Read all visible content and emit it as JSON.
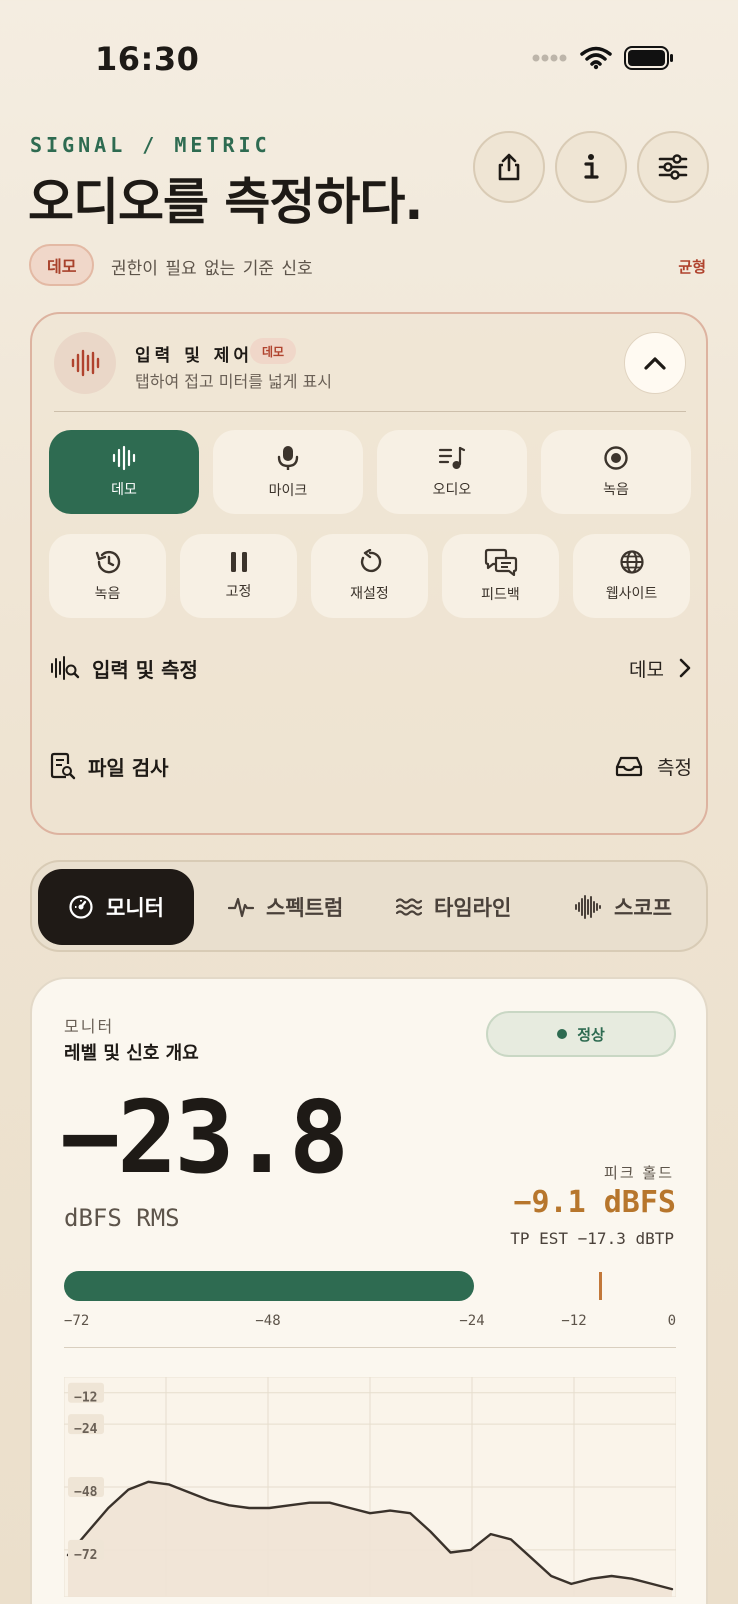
{
  "status_bar": {
    "time": "16:30"
  },
  "header": {
    "eyebrow": "SIGNAL / METRIC",
    "title": "오디오를 측정하다.",
    "demo_pill": "데모",
    "caption": "권한이 필요 없는 기준 신호",
    "balance_label": "균형"
  },
  "control_card": {
    "title": "입력 및 제어",
    "badge": "데모",
    "subtitle": "탭하여 접고 미터를 넓게 표시",
    "sources": [
      {
        "label": "데모",
        "icon": "waveform-icon",
        "active": true
      },
      {
        "label": "마이크",
        "icon": "microphone-icon",
        "active": false
      },
      {
        "label": "오디오",
        "icon": "music-list-icon",
        "active": false
      },
      {
        "label": "녹음",
        "icon": "record-icon",
        "active": false
      }
    ],
    "actions": [
      {
        "label": "녹음",
        "icon": "history-icon"
      },
      {
        "label": "고정",
        "icon": "pause-icon"
      },
      {
        "label": "재설정",
        "icon": "reset-icon"
      },
      {
        "label": "피드백",
        "icon": "feedback-icon"
      },
      {
        "label": "웹사이트",
        "icon": "globe-icon"
      }
    ],
    "input_row": {
      "label": "입력 및 측정",
      "value": "데모"
    },
    "file_row": {
      "label": "파일 검사",
      "action": "측정"
    }
  },
  "tabs": [
    {
      "label": "모니터",
      "icon": "gauge-icon",
      "active": true
    },
    {
      "label": "스펙트럼",
      "icon": "pulse-icon",
      "active": false
    },
    {
      "label": "타임라인",
      "icon": "waves-icon",
      "active": false
    },
    {
      "label": "스코프",
      "icon": "scope-wave-icon",
      "active": false
    }
  ],
  "monitor": {
    "eyebrow": "모니터",
    "title": "레벨 및 신호 개요",
    "status": "정상",
    "rms_value": "−23.8",
    "rms_unit": "dBFS RMS",
    "peak_label": "피크 홀드",
    "peak_value": "−9.1 dBFS",
    "tp_est": "TP EST −17.3 dBTP",
    "meter": {
      "min": -72,
      "max": 0,
      "rms_level": -23.8,
      "peak_level": -9.1,
      "scale": [
        "−72",
        "−48",
        "−24",
        "−12",
        "0"
      ],
      "scale_values": [
        -72,
        -48,
        -24,
        -12,
        0
      ]
    }
  },
  "chart_data": {
    "type": "area",
    "y_labels": [
      "−12",
      "−24",
      "−48",
      "−72"
    ],
    "y_label_values": [
      -12,
      -24,
      -48,
      -72
    ],
    "ylim": [
      -90,
      -6
    ],
    "grid": true,
    "x": [
      0,
      1,
      2,
      3,
      4,
      5,
      6,
      7,
      8,
      9,
      10,
      11,
      12,
      13,
      14,
      15,
      16,
      17,
      18,
      19,
      20,
      21,
      22,
      23,
      24,
      25,
      26,
      27,
      28,
      29,
      30
    ],
    "values": [
      -74,
      -65,
      -56,
      -49,
      -46,
      -47,
      -50,
      -53,
      -55,
      -56,
      -56,
      -55,
      -54,
      -54,
      -56,
      -58,
      -57,
      -58,
      -65,
      -73,
      -72,
      -66,
      -68,
      -75,
      -82,
      -85,
      -83,
      -82,
      -83,
      -85,
      -87
    ]
  },
  "colors": {
    "accent_green": "#2e6b51",
    "alert_red": "#b0432e",
    "peak_amber": "#b7762c",
    "dark": "#1f1a16"
  }
}
